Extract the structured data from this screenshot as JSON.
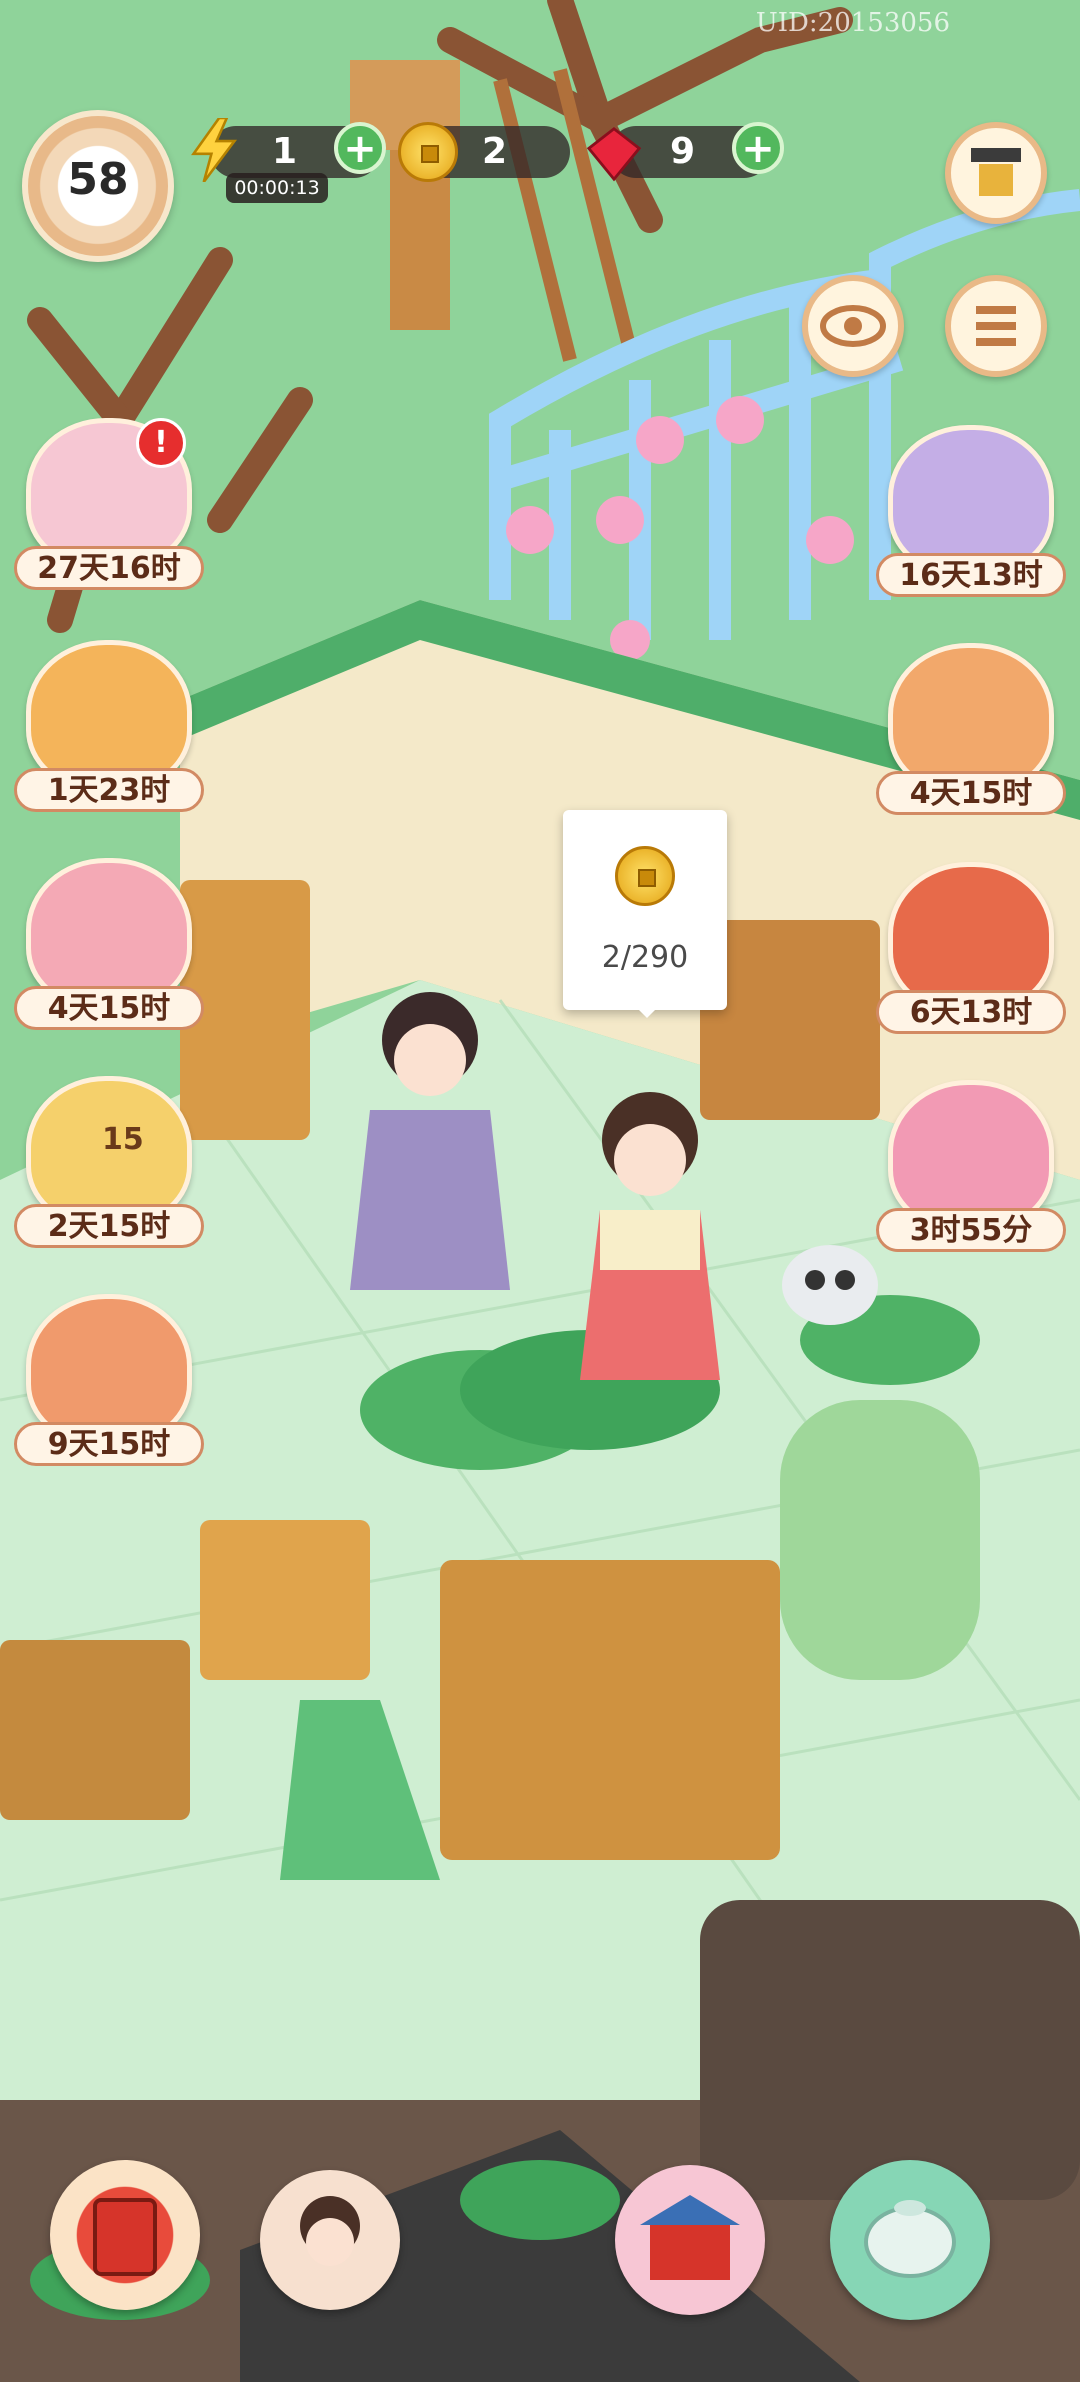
{
  "uid": "UID:20153056",
  "player": {
    "level": "58"
  },
  "resources": {
    "energy": {
      "value": "1",
      "timer": "00:00:13"
    },
    "coins": {
      "value": "2"
    },
    "gems": {
      "value": "9"
    }
  },
  "left_events": [
    {
      "label": "27天16时",
      "icon": "scroll-flowers-icon",
      "alert": "!"
    },
    {
      "label": "1天23时",
      "icon": "treasure-chest-icon"
    },
    {
      "label": "4天15时",
      "icon": "pink-pig-icon"
    },
    {
      "label": "2天15时",
      "icon": "peacock-icon",
      "count": "15"
    },
    {
      "label": "9天15时",
      "icon": "pipa-lute-icon"
    }
  ],
  "right_events": [
    {
      "label": "16天13时",
      "icon": "cat-pillow-icon"
    },
    {
      "label": "4天15时",
      "icon": "lucky-cat-icon"
    },
    {
      "label": "6天13时",
      "icon": "red-chest-icon"
    },
    {
      "label": "3时55分",
      "icon": "gift-box-icon"
    }
  ],
  "tooltip": {
    "progress": "2/290"
  },
  "bottom_nav": [
    "book-icon",
    "character-icon",
    "shop-stall-icon",
    "tea-pot-icon"
  ],
  "colors": {
    "grass": "#8fd39a",
    "floor": "#cfeed2",
    "wall": "#f4e9c9",
    "label_border": "#d28a63"
  }
}
